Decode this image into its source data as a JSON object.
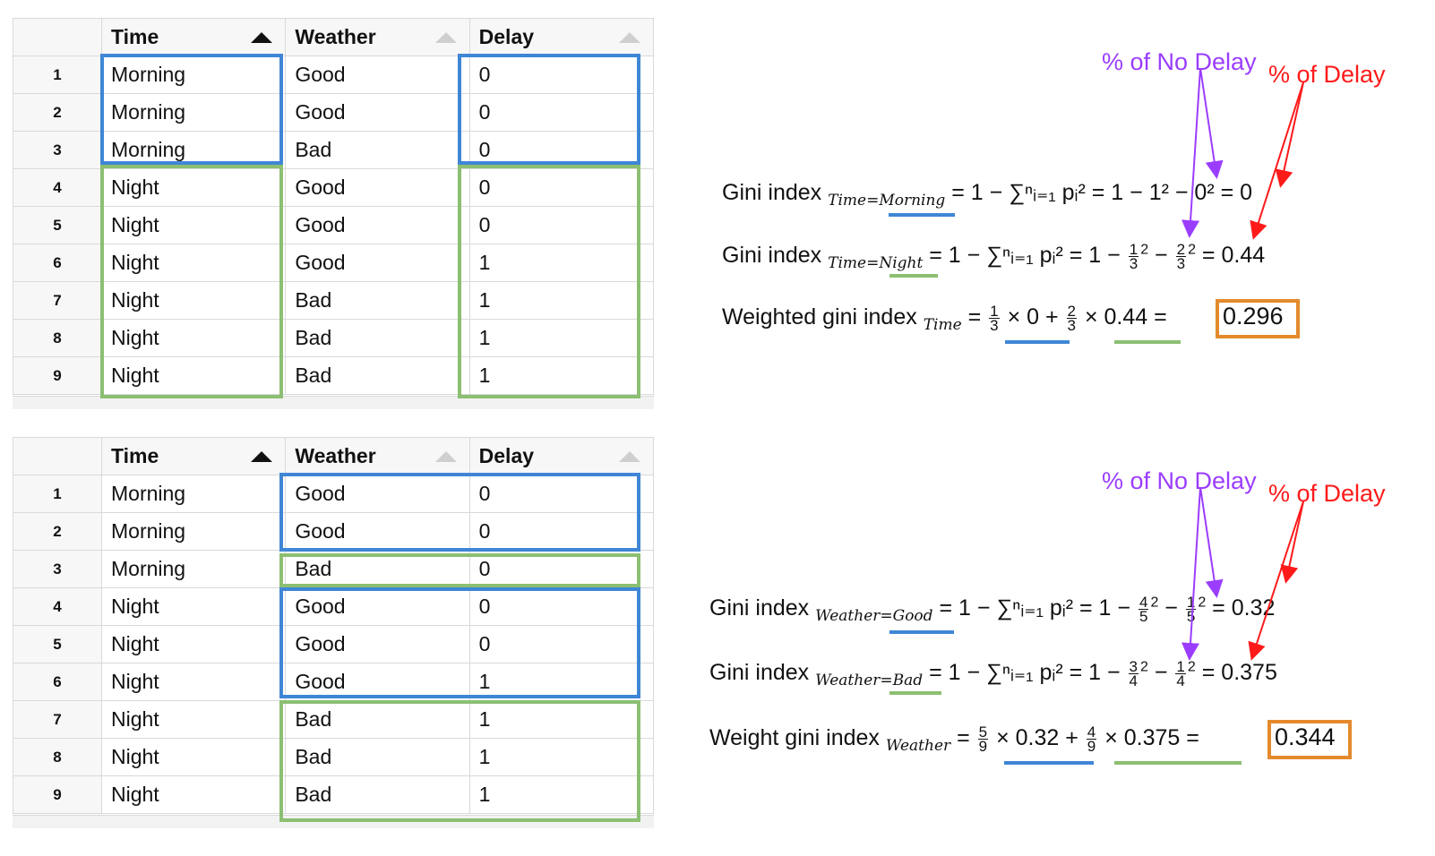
{
  "columns": [
    "Time",
    "Weather",
    "Delay"
  ],
  "rows": [
    {
      "idx": "1",
      "time": "Morning",
      "weather": "Good",
      "delay": "0"
    },
    {
      "idx": "2",
      "time": "Morning",
      "weather": "Good",
      "delay": "0"
    },
    {
      "idx": "3",
      "time": "Morning",
      "weather": "Bad",
      "delay": "0"
    },
    {
      "idx": "4",
      "time": "Night",
      "weather": "Good",
      "delay": "0"
    },
    {
      "idx": "5",
      "time": "Night",
      "weather": "Good",
      "delay": "0"
    },
    {
      "idx": "6",
      "time": "Night",
      "weather": "Good",
      "delay": "1"
    },
    {
      "idx": "7",
      "time": "Night",
      "weather": "Bad",
      "delay": "1"
    },
    {
      "idx": "8",
      "time": "Night",
      "weather": "Bad",
      "delay": "1"
    },
    {
      "idx": "9",
      "time": "Night",
      "weather": "Bad",
      "delay": "1"
    }
  ],
  "annotations": {
    "no_delay": "% of No Delay",
    "delay": "% of Delay"
  },
  "time_panel": {
    "gini_morning_label": "Gini index",
    "gini_morning_sub": "Time=Morning",
    "gini_morning_expr": "= 1 − ∑ⁿᵢ₌₁ pᵢ² = 1 − 1² − 0² = 0",
    "gini_night_label": "Gini index",
    "gini_night_sub": "Time=Night",
    "gini_night_expr_a": "= 1 − ∑ⁿᵢ₌₁ pᵢ² = 1 −",
    "gini_night_frac1": [
      "1",
      "3"
    ],
    "gini_night_frac2": [
      "2",
      "3"
    ],
    "gini_night_result": "= 0.44",
    "weighted_label": "Weighted gini index",
    "weighted_sub": "Time",
    "weighted_frac1": [
      "1",
      "3"
    ],
    "weighted_term1": "× 0 +",
    "weighted_frac2": [
      "2",
      "3"
    ],
    "weighted_term2": "× 0.44 =",
    "weighted_result": "0.296"
  },
  "weather_panel": {
    "gini_good_label": "Gini index",
    "gini_good_sub": "Weather=Good",
    "gini_good_expr_a": "= 1 − ∑ⁿᵢ₌₁ pᵢ² = 1 −",
    "gini_good_frac1": [
      "4",
      "5"
    ],
    "gini_good_frac2": [
      "1",
      "5"
    ],
    "gini_good_result": "= 0.32",
    "gini_bad_label": "Gini index",
    "gini_bad_sub": "Weather=Bad",
    "gini_bad_expr_a": "= 1 − ∑ⁿᵢ₌₁ pᵢ² = 1 −",
    "gini_bad_frac1": [
      "3",
      "4"
    ],
    "gini_bad_frac2": [
      "1",
      "4"
    ],
    "gini_bad_result": "= 0.375",
    "weighted_label": "Weight gini index",
    "weighted_sub": "Weather",
    "weighted_frac1": [
      "5",
      "9"
    ],
    "weighted_term1": "× 0.32 +",
    "weighted_frac2": [
      "4",
      "9"
    ],
    "weighted_term2": "× 0.375 =",
    "weighted_result": "0.344"
  },
  "colors": {
    "blue_group": "#3f86d6",
    "green_group": "#8cbf72",
    "result_box": "#e48a2d",
    "no_delay_arrow": "#9b3dff",
    "delay_arrow": "#ff1a1a"
  },
  "icons": {
    "sort_active": "sort-ascending-icon",
    "sort_inactive": "sort-neutral-icon"
  }
}
